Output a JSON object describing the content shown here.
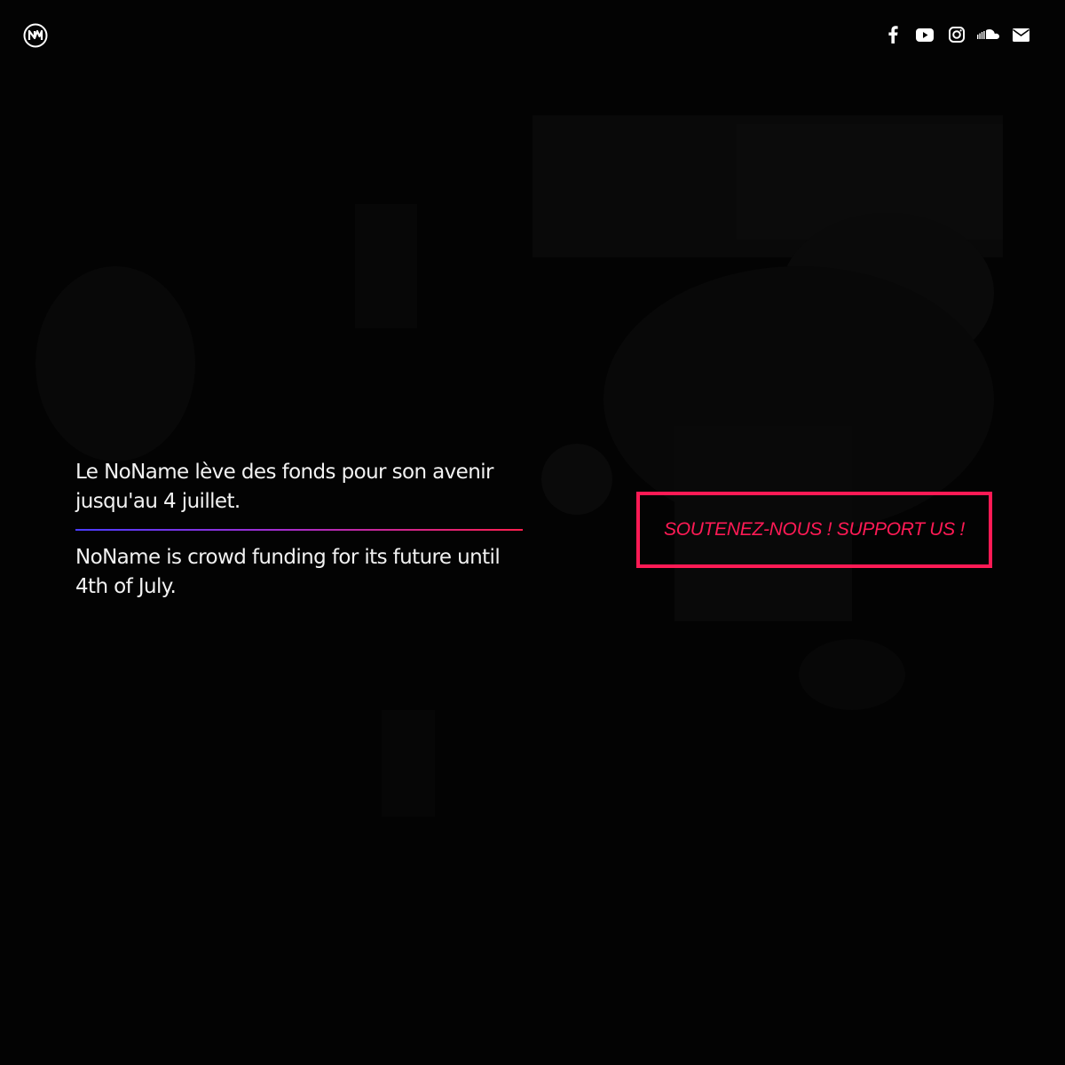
{
  "header": {
    "logo_icon": "noname-logo-icon",
    "social": [
      {
        "name": "facebook",
        "icon": "facebook-icon"
      },
      {
        "name": "youtube",
        "icon": "youtube-icon"
      },
      {
        "name": "instagram",
        "icon": "instagram-icon"
      },
      {
        "name": "soundcloud",
        "icon": "soundcloud-icon"
      },
      {
        "name": "email",
        "icon": "envelope-icon"
      }
    ]
  },
  "hero": {
    "text_fr": "Le NoName lève des fonds pour son avenir jusqu'au 4 juillet.",
    "text_en": "NoName is crowd funding for its future until 4th of July.",
    "cta_label": "SOUTENEZ-NOUS ! SUPPORT US !"
  },
  "colors": {
    "background": "#030303",
    "accent": "#ff1a55",
    "text": "#f2f2f2",
    "divider_start": "#4a3cff",
    "divider_end": "#ff1f4e"
  }
}
